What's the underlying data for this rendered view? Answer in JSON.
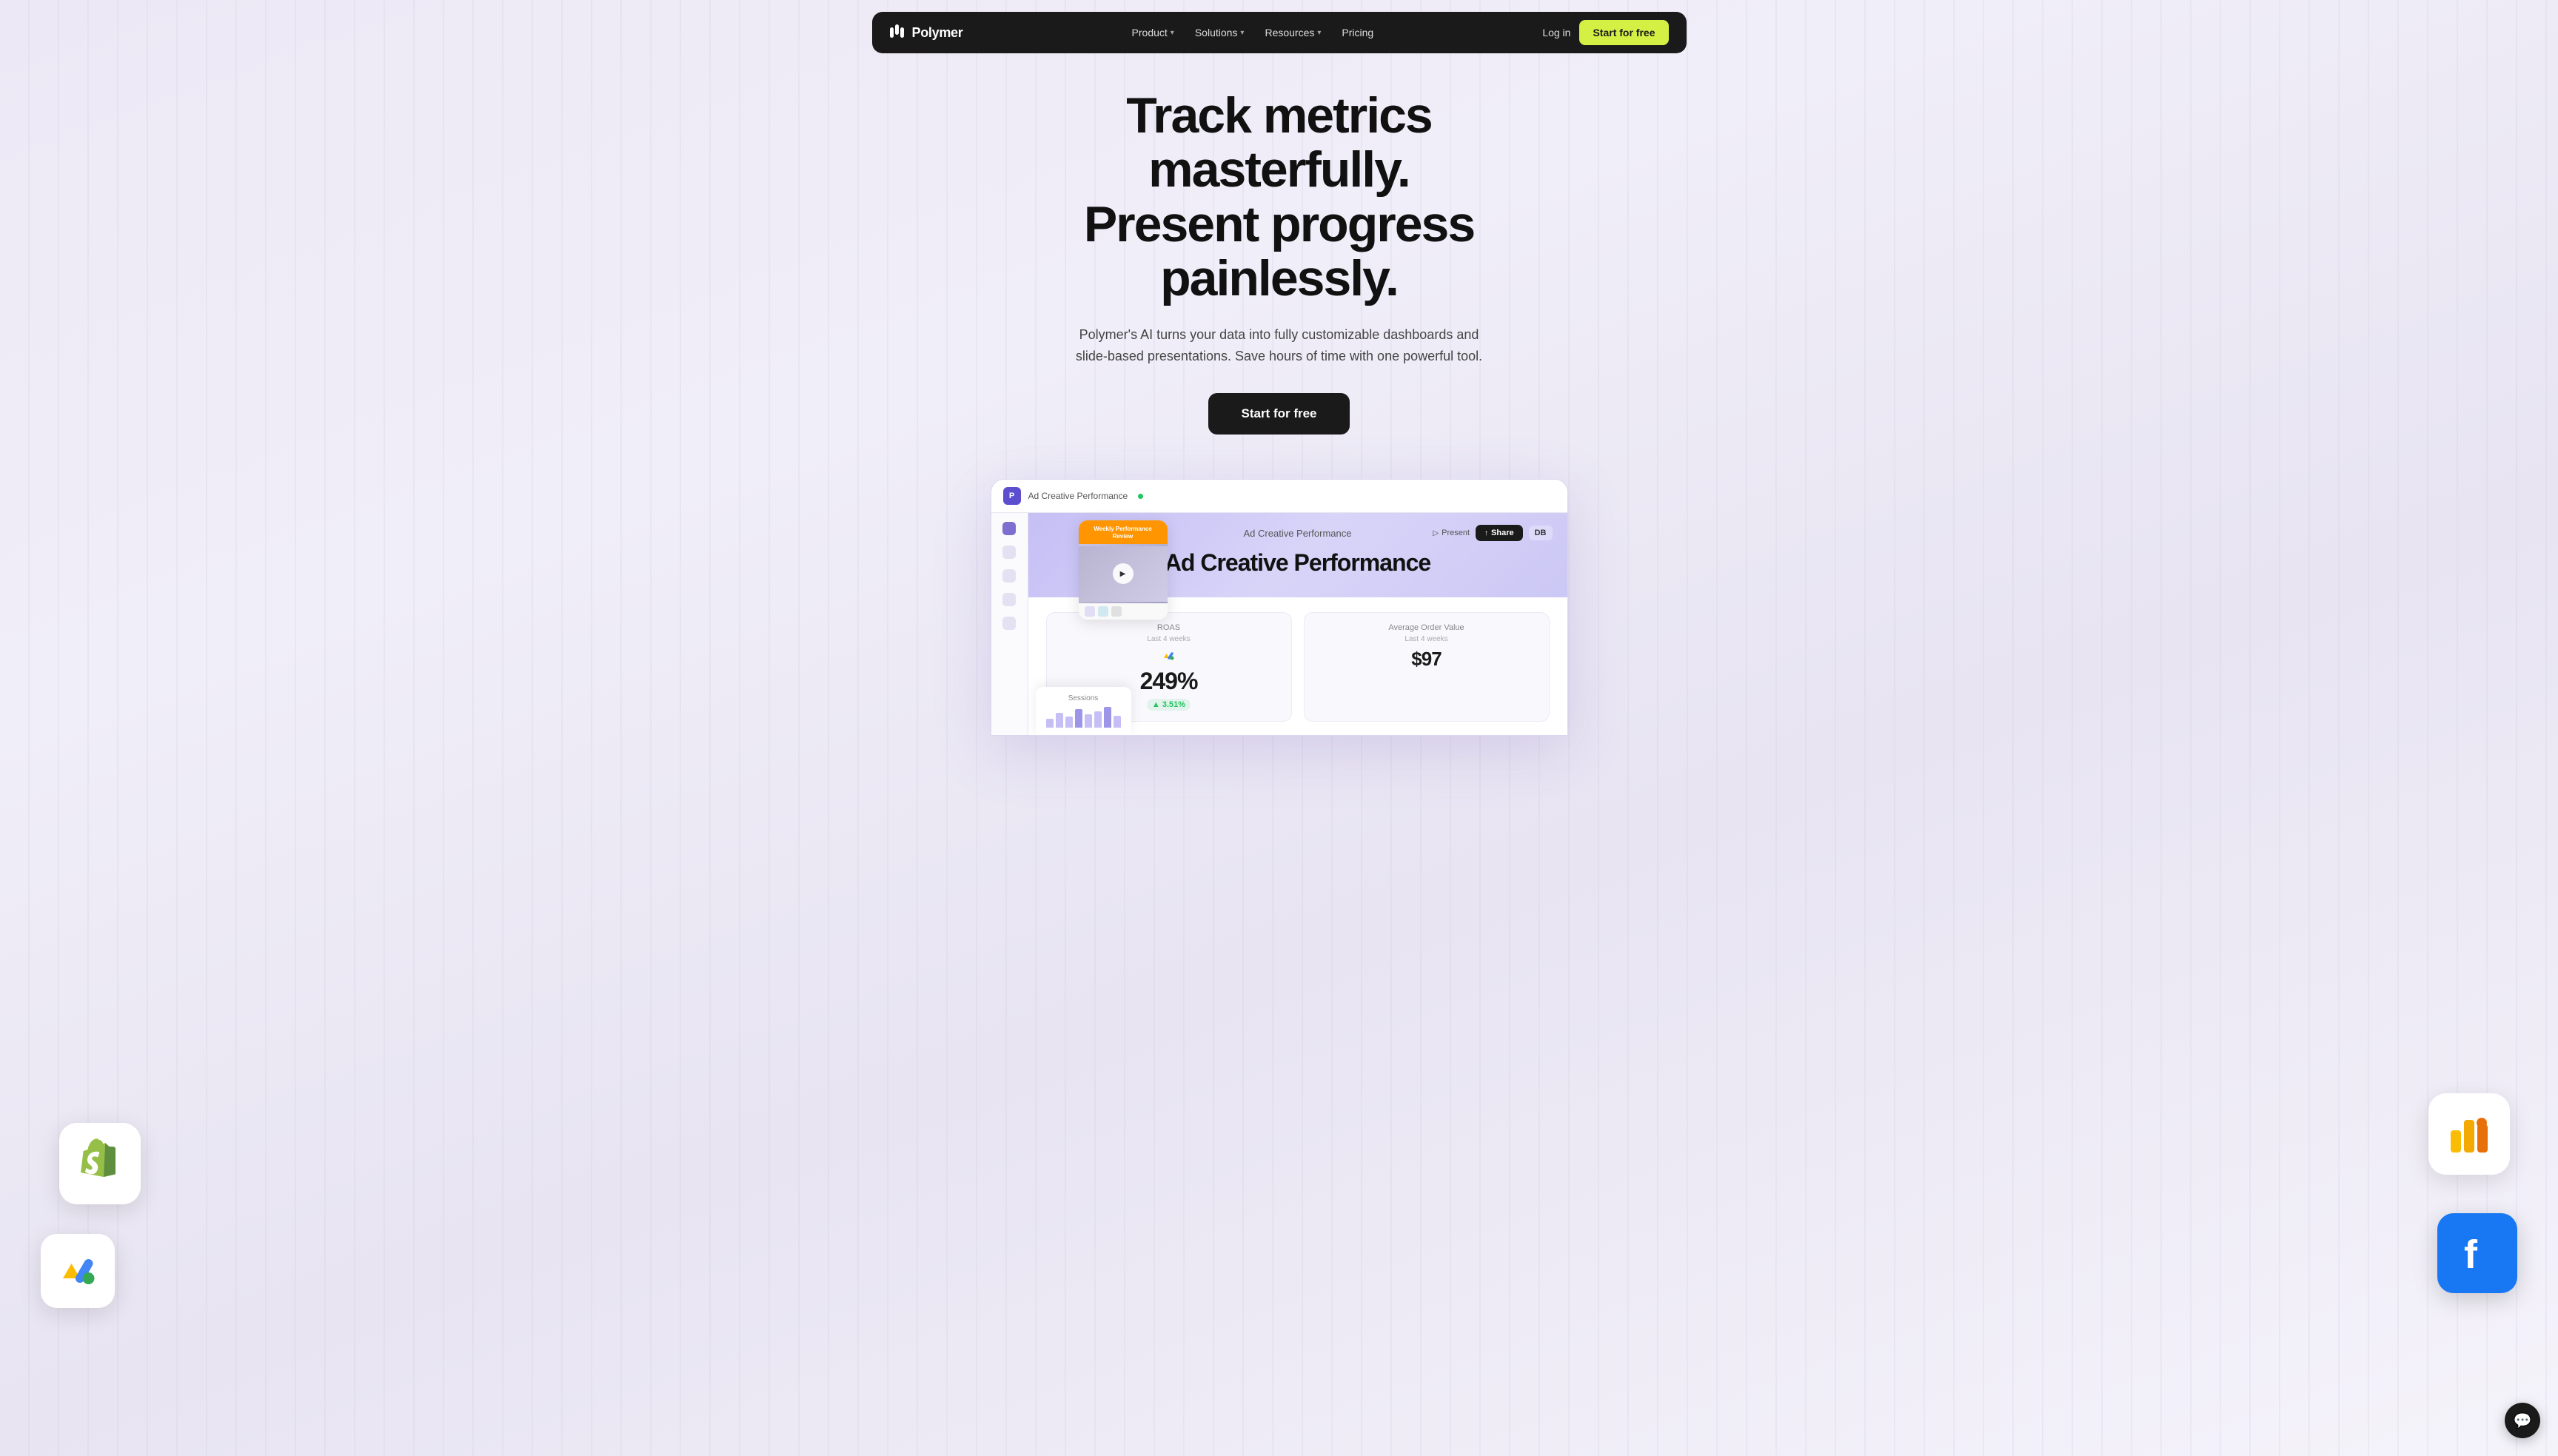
{
  "nav": {
    "logo_text": "Polymer",
    "links": [
      {
        "id": "product",
        "label": "Product",
        "has_dropdown": true
      },
      {
        "id": "solutions",
        "label": "Solutions",
        "has_dropdown": true
      },
      {
        "id": "resources",
        "label": "Resources",
        "has_dropdown": true
      },
      {
        "id": "pricing",
        "label": "Pricing",
        "has_dropdown": false
      }
    ],
    "login_label": "Log in",
    "cta_label": "Start for free"
  },
  "hero": {
    "title_line1": "Track metrics masterfully.",
    "title_line2": "Present progress painlessly.",
    "subtitle": "Polymer's AI turns your data into fully customizable dashboards and slide-based presentations. Save hours of time with one powerful tool.",
    "cta_label": "Start for free"
  },
  "dashboard": {
    "topbar_title": "Ad Creative Performance",
    "present_label": "Present",
    "share_label": "Share",
    "db_badge": "DB",
    "header_title": "Ad Creative Performance",
    "video_widget_label": "Weekly Performance Review",
    "metrics": [
      {
        "label": "ROAS",
        "sub_label": "Last 4 weeks",
        "value": "249%",
        "change": "▲ 3.51%",
        "icon_color": "#4285F4"
      },
      {
        "label": "Average Order Value",
        "sub_label": "Last 4 weeks",
        "value": "$97",
        "change": "",
        "icon_color": "#34a853"
      }
    ],
    "sessions_label": "Sessions"
  },
  "floating_icons": {
    "shopify_alt": "Shopify",
    "google_ads_alt": "Google Ads",
    "looker_alt": "Google Looker Studio",
    "facebook_alt": "Facebook"
  },
  "chat": {
    "icon": "💬"
  }
}
